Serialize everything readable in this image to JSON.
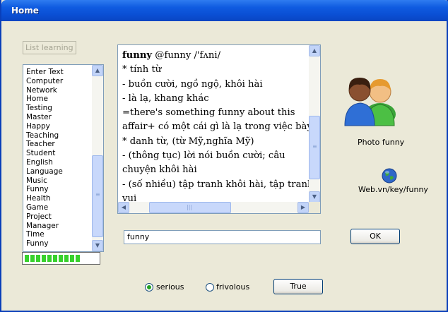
{
  "window": {
    "title": "Home"
  },
  "list_learning_button": "List learning",
  "word_list": {
    "items": [
      "Enter Text",
      "Computer",
      "Network",
      "Home",
      "Testing",
      "Master",
      "Happy",
      "Teaching",
      "Teacher",
      "Student",
      "English",
      "Language",
      "Music",
      "Funny",
      "Health",
      "Game",
      "Project",
      "Manager",
      "Time",
      "Funny"
    ]
  },
  "progress": {
    "segments": 10
  },
  "definition": {
    "headword": "funny",
    "pron": " @funny /'fʌni/",
    "lines": [
      "* tính từ",
      "- buồn cười, ngồ ngộ, khôi hài",
      "- là lạ, khang khác",
      "=there's something funny about this",
      "affair+ có một cái gì là lạ trong việc bày",
      "* danh từ, (từ Mỹ,nghĩa Mỹ)",
      "- (thông tục) lời nói buồn cười; câu",
      "chuyện khôi hài",
      "- (số nhiều) tập tranh khôi hài, tập tranh",
      "vui"
    ]
  },
  "photo": {
    "caption": "Photo funny",
    "icon": "users-icon"
  },
  "web": {
    "caption": "Web.vn/key/funny",
    "icon": "globe-icon"
  },
  "search": {
    "value": "funny"
  },
  "ok_label": "OK",
  "options": {
    "serious": "serious",
    "frivolous": "frivolous",
    "selected": "serious"
  },
  "true_label": "True"
}
